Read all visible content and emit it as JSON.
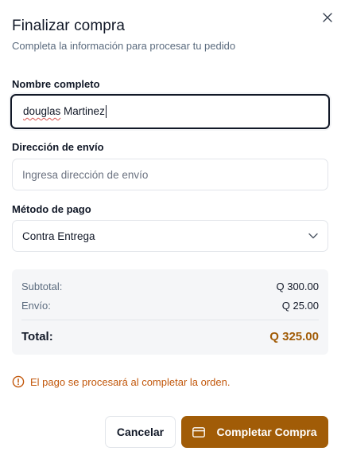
{
  "dialog": {
    "title": "Finalizar compra",
    "subtitle": "Completa la información para procesar tu pedido"
  },
  "form": {
    "name": {
      "label": "Nombre completo",
      "value_first": "douglas",
      "value_rest": " Martinez"
    },
    "address": {
      "label": "Dirección de envío",
      "placeholder": "Ingresa dirección de envío"
    },
    "payment": {
      "label": "Método de pago",
      "selected": "Contra Entrega"
    }
  },
  "summary": {
    "subtotal_label": "Subtotal:",
    "subtotal_value": "Q 300.00",
    "shipping_label": "Envío:",
    "shipping_value": "Q 25.00",
    "total_label": "Total:",
    "total_value": "Q 325.00"
  },
  "notice": {
    "text": "El pago se procesará al completar la orden.",
    "icon": "alert-circle-icon"
  },
  "actions": {
    "cancel_label": "Cancelar",
    "complete_label": "Completar Compra",
    "complete_icon": "credit-card-icon"
  },
  "colors": {
    "accent": "#a15c07",
    "notice": "#c2580c",
    "muted": "#5b6b7e"
  }
}
